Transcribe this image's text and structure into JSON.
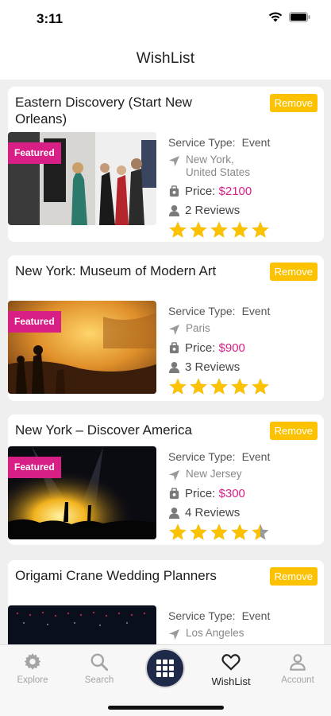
{
  "status": {
    "time": "3:11"
  },
  "header": {
    "title": "WishList"
  },
  "labels": {
    "service_type": "Service Type:",
    "price": "Price:",
    "remove": "Remove",
    "featured": "Featured"
  },
  "cards": [
    {
      "title": "Eastern Discovery (Start New Orleans)",
      "service_type": "Event",
      "location": "New York, United States",
      "price": "$2100",
      "reviews": "2 Reviews",
      "rating": 5,
      "featured": true
    },
    {
      "title": "New York: Museum of Modern Art",
      "service_type": "Event",
      "location": "Paris",
      "price": "$900",
      "reviews": "3 Reviews",
      "rating": 5,
      "featured": true
    },
    {
      "title": "New York – Discover America",
      "service_type": "Event",
      "location": "New Jersey",
      "price": "$300",
      "reviews": "4 Reviews",
      "rating": 4.5,
      "featured": true
    },
    {
      "title": "Origami Crane Wedding Planners",
      "service_type": "Event",
      "location": "Los Angeles",
      "price": "",
      "reviews": "",
      "rating": 0,
      "featured": false
    }
  ],
  "tabs": [
    {
      "label": "Explore",
      "icon": "gear-icon",
      "active": false
    },
    {
      "label": "Search",
      "icon": "search-icon",
      "active": false
    },
    {
      "label": "",
      "icon": "grid-icon",
      "active": false
    },
    {
      "label": "WishList",
      "icon": "heart-icon",
      "active": true
    },
    {
      "label": "Account",
      "icon": "user-icon",
      "active": false
    }
  ],
  "colors": {
    "accent": "#d81f86",
    "remove": "#fcc200",
    "star": "#fcc200",
    "center_button": "#1f2a4a"
  }
}
